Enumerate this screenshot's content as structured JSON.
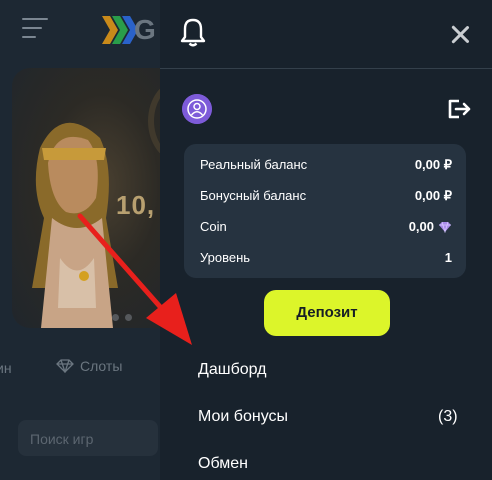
{
  "background": {
    "logo_text": "G",
    "banner_number": "10,",
    "category_partial": "ин",
    "category_slots": "Слоты",
    "search_placeholder": "Поиск игр"
  },
  "drawer": {
    "balance": {
      "rows": [
        {
          "label": "Реальный баланс",
          "value": "0,00 ₽"
        },
        {
          "label": "Бонусный баланс",
          "value": "0,00 ₽"
        },
        {
          "label": "Coin",
          "value": "0,00"
        },
        {
          "label": "Уровень",
          "value": "1"
        }
      ]
    },
    "deposit_label": "Депозит",
    "menu": [
      {
        "label": "Дашборд",
        "count": ""
      },
      {
        "label": "Мои бонусы",
        "count": "(3)"
      },
      {
        "label": "Обмен",
        "count": ""
      }
    ]
  },
  "colors": {
    "accent": "#dcf52a",
    "drawer_bg": "#18222c",
    "card_bg": "#263340",
    "avatar": "#7d5bd9",
    "arrow": "#e8201c"
  },
  "icons": [
    "menu-icon",
    "bell-icon",
    "close-icon",
    "user-avatar-icon",
    "logout-icon",
    "diamond-icon"
  ]
}
